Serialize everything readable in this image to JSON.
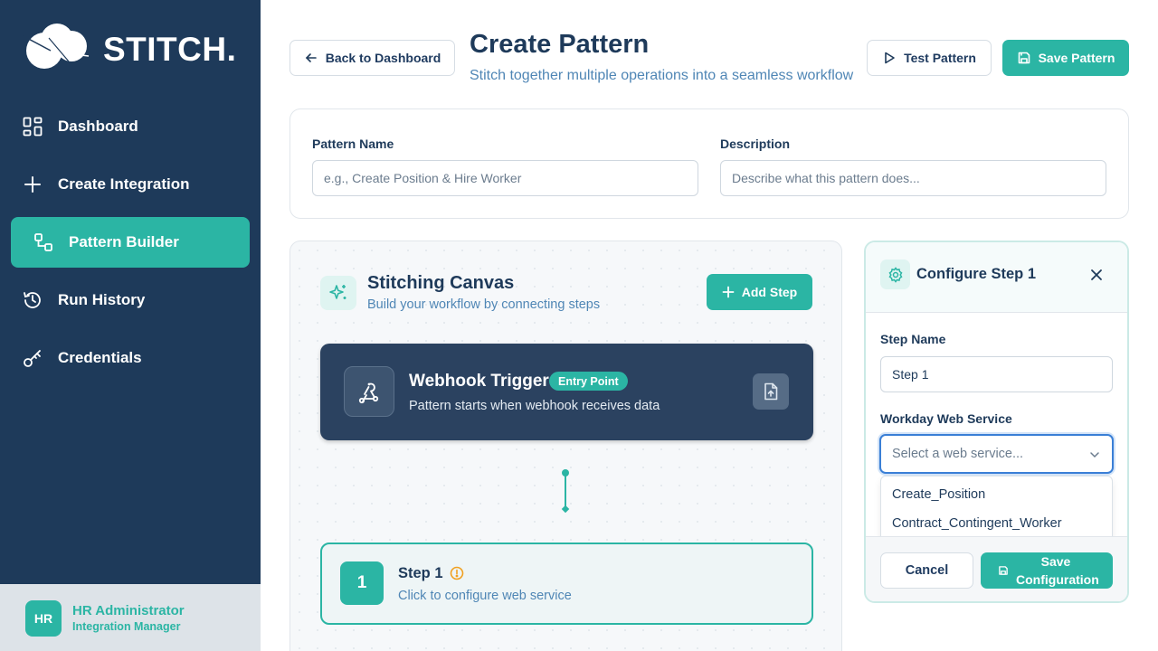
{
  "app": {
    "brand": "STITCH."
  },
  "sidebar": {
    "items": [
      {
        "label": "Dashboard",
        "icon": "dashboard-icon",
        "active": false
      },
      {
        "label": "Create Integration",
        "icon": "plus-icon",
        "active": false
      },
      {
        "label": "Pattern Builder",
        "icon": "pattern-icon",
        "active": true
      },
      {
        "label": "Run History",
        "icon": "history-icon",
        "active": false
      },
      {
        "label": "Credentials",
        "icon": "key-icon",
        "active": false
      }
    ],
    "user": {
      "initials": "HR",
      "name": "HR Administrator",
      "role": "Integration Manager"
    }
  },
  "header": {
    "back_label": "Back to Dashboard",
    "title": "Create Pattern",
    "subtitle": "Stitch together multiple operations into a seamless workflow",
    "test_label": "Test Pattern",
    "save_label": "Save Pattern"
  },
  "form": {
    "name_label": "Pattern Name",
    "name_placeholder": "e.g., Create Position & Hire Worker",
    "name_value": "",
    "description_label": "Description",
    "description_placeholder": "Describe what this pattern does...",
    "description_value": ""
  },
  "canvas": {
    "title": "Stitching Canvas",
    "subtitle": "Build your workflow by connecting steps",
    "add_step_label": "Add Step",
    "trigger": {
      "title": "Webhook Trigger",
      "badge": "Entry Point",
      "description": "Pattern starts when webhook receives data"
    },
    "steps": [
      {
        "number": "1",
        "title": "Step 1",
        "description": "Click to configure web service"
      }
    ]
  },
  "config": {
    "title": "Configure Step 1",
    "step_name_label": "Step Name",
    "step_name_value": "Step 1",
    "web_service_label": "Workday Web Service",
    "web_service_placeholder": "Select a web service...",
    "options": [
      "Create_Position",
      "Contract_Contingent_Worker"
    ],
    "cancel_label": "Cancel",
    "save_label": "Save Configuration"
  },
  "colors": {
    "sidebar_bg": "#1e3a5a",
    "accent": "#2bb5a4",
    "subtitle": "#4f86b5",
    "focus_border": "#3a7fd6",
    "warning": "#f0a020"
  }
}
